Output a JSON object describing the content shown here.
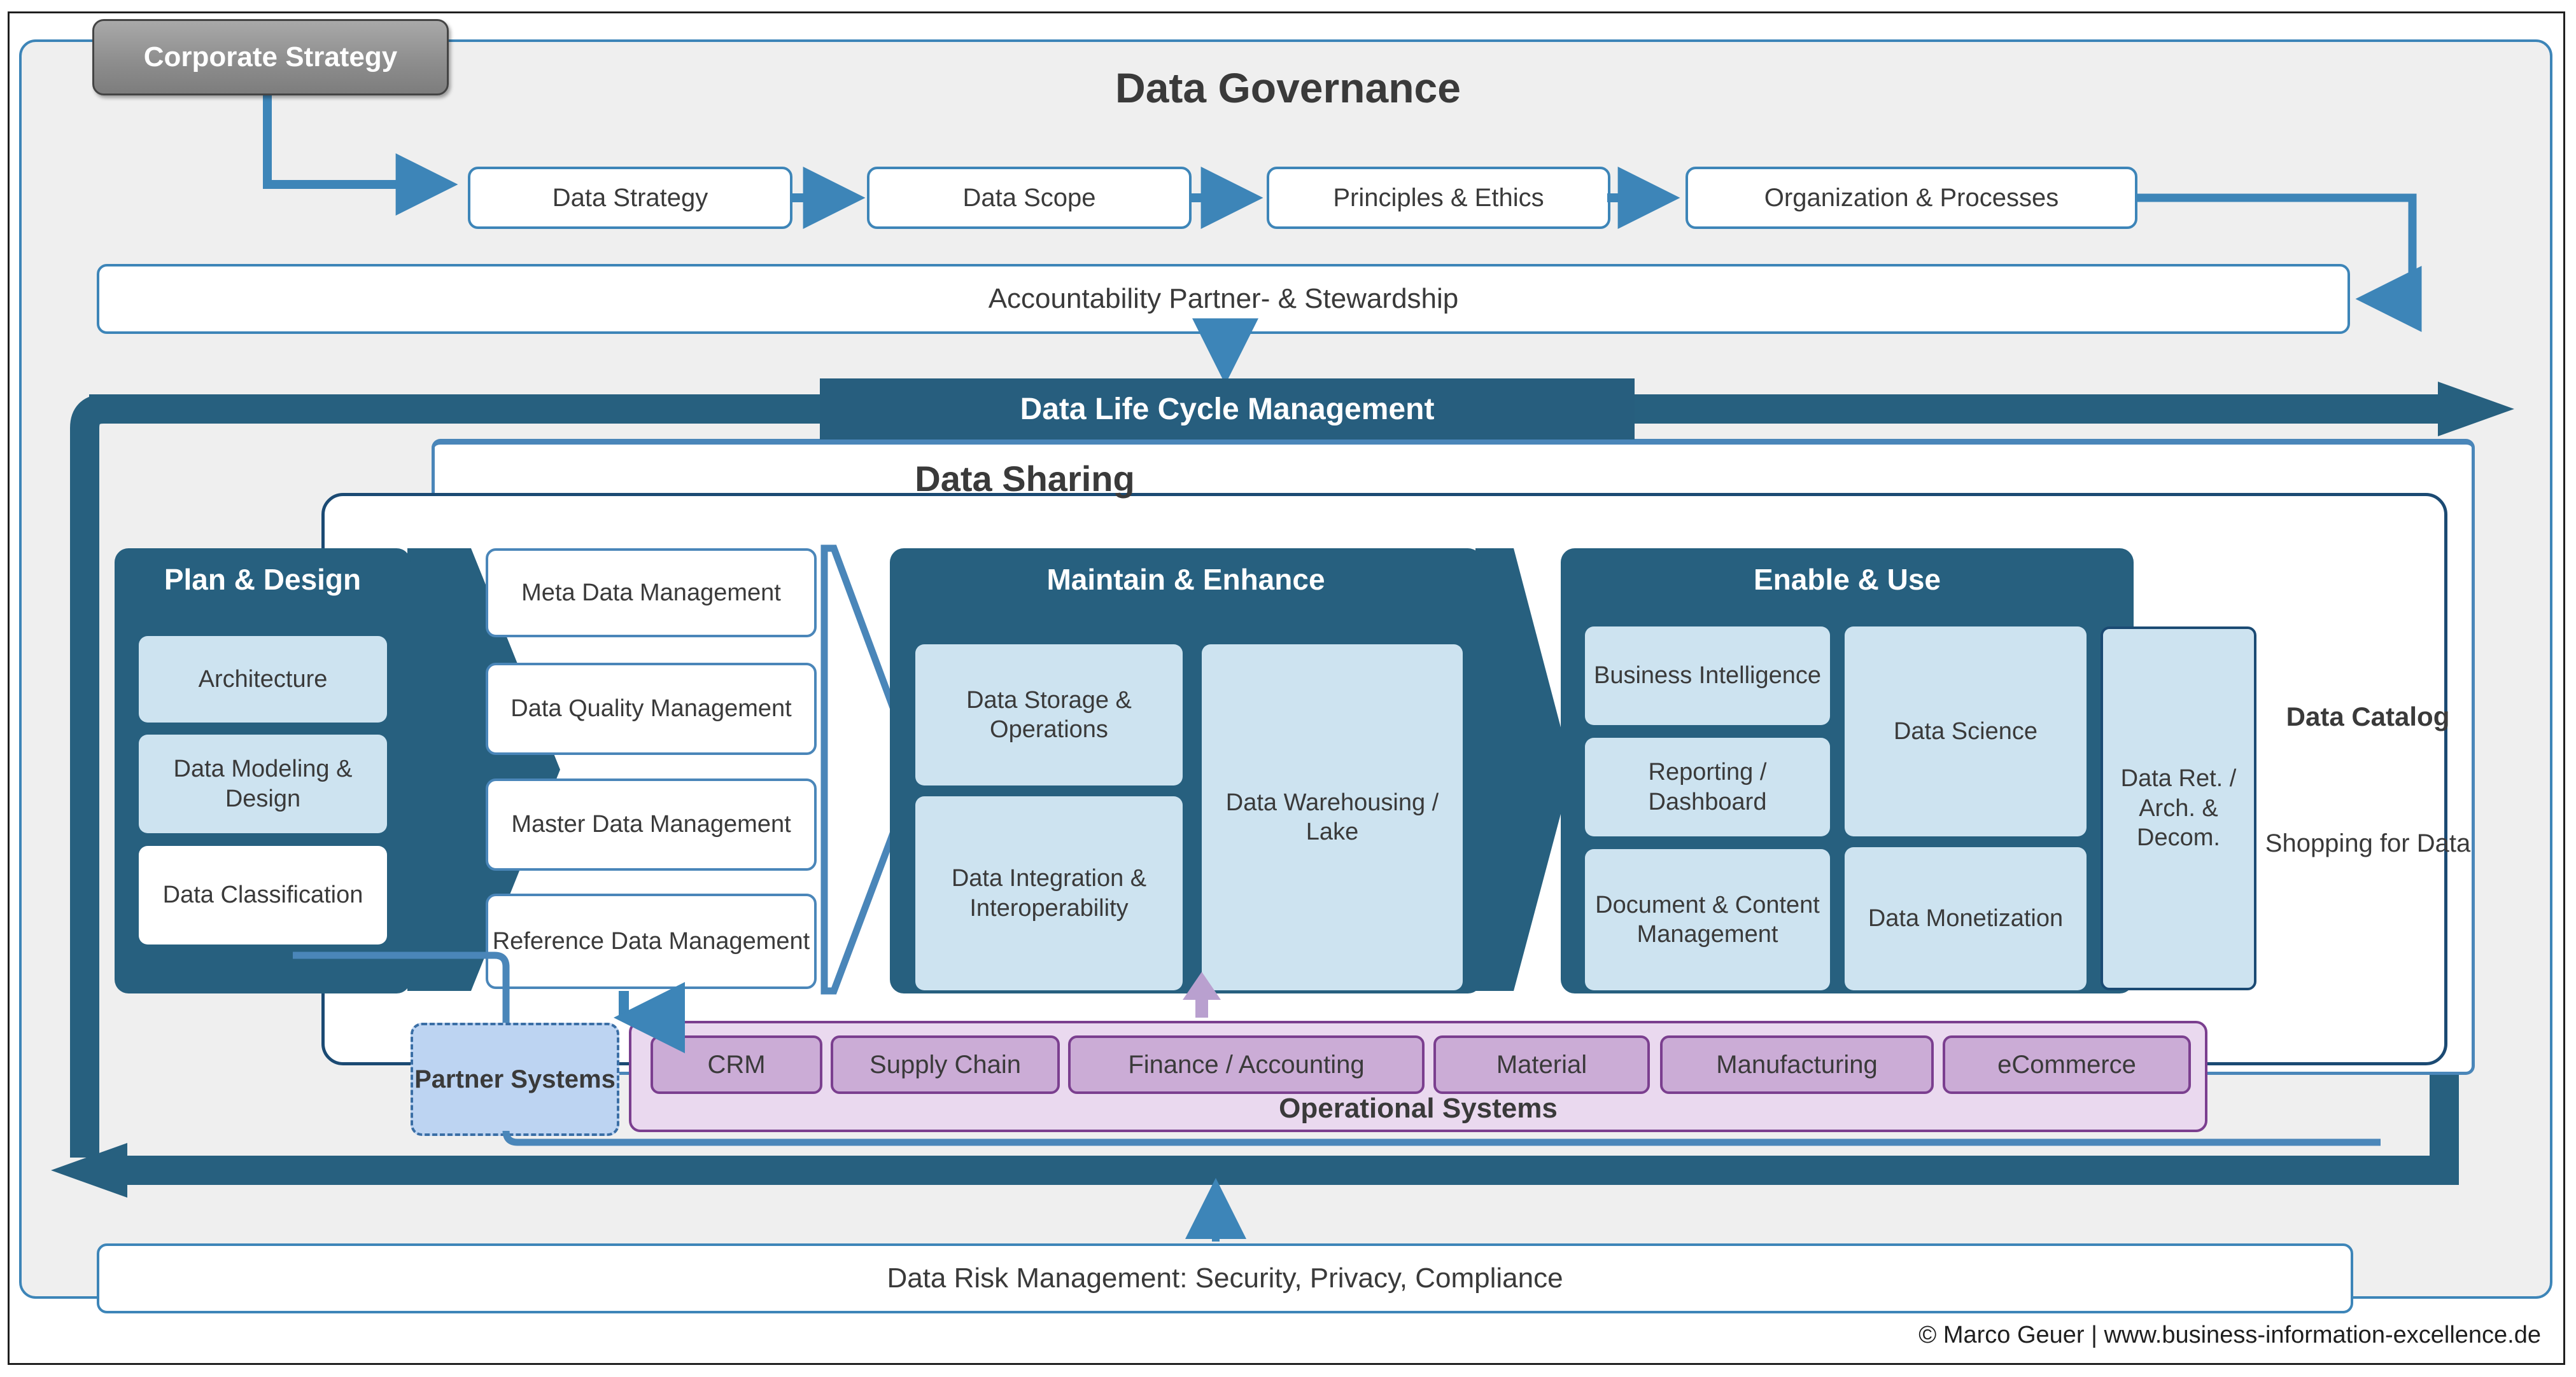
{
  "diagram": {
    "corporate_strategy": "Corporate Strategy",
    "governance_title": "Data Governance",
    "governance_steps": [
      "Data Strategy",
      "Data Scope",
      "Principles & Ethics",
      "Organization & Processes"
    ],
    "accountability": "Accountability Partner- & Stewardship",
    "lifecycle_banner": "Data Life Cycle Management",
    "data_sharing": "Data Sharing",
    "stages": [
      {
        "title": "Plan & Design",
        "items": [
          "Architecture",
          "Data Modeling & Design",
          "Data Classification"
        ]
      },
      {
        "title": "Maintain & Enhance",
        "items": [
          "Data Storage & Operations",
          "Data Integration & Interoperability",
          "Data Warehousing / Lake"
        ]
      },
      {
        "title": "Enable & Use",
        "items": [
          "Business Intelligence",
          "Reporting / Dashboard",
          "Document & Content Management",
          "Data Science",
          "Data Monetization",
          "Data Ret. / Arch. & Decom."
        ]
      }
    ],
    "data_management": [
      "Meta Data Management",
      "Data Quality Management",
      "Master Data Management",
      "Reference Data Management"
    ],
    "catalog": {
      "title": "Data Catalog",
      "subtitle": "Shopping for Data"
    },
    "partner_systems": "Partner Systems",
    "operational_systems": {
      "label": "Operational Systems",
      "chips": [
        "CRM",
        "Supply Chain",
        "Finance / Accounting",
        "Material",
        "Manufacturing",
        "eCommerce"
      ]
    },
    "risk_management": "Data Risk Management: Security, Privacy, Compliance",
    "credit": "© Marco Geuer | www.business-information-excellence.de",
    "colors": {
      "accent_blue": "#3d85b8",
      "dark_blue": "#27607f",
      "deep_navy": "#1b4a73",
      "light_blue": "#cde3f0",
      "purple": "#7b3f8f",
      "purple_fill": "#cbacd6",
      "panel_bg": "#efefef",
      "partner_fill": "#bdd4f2"
    }
  }
}
